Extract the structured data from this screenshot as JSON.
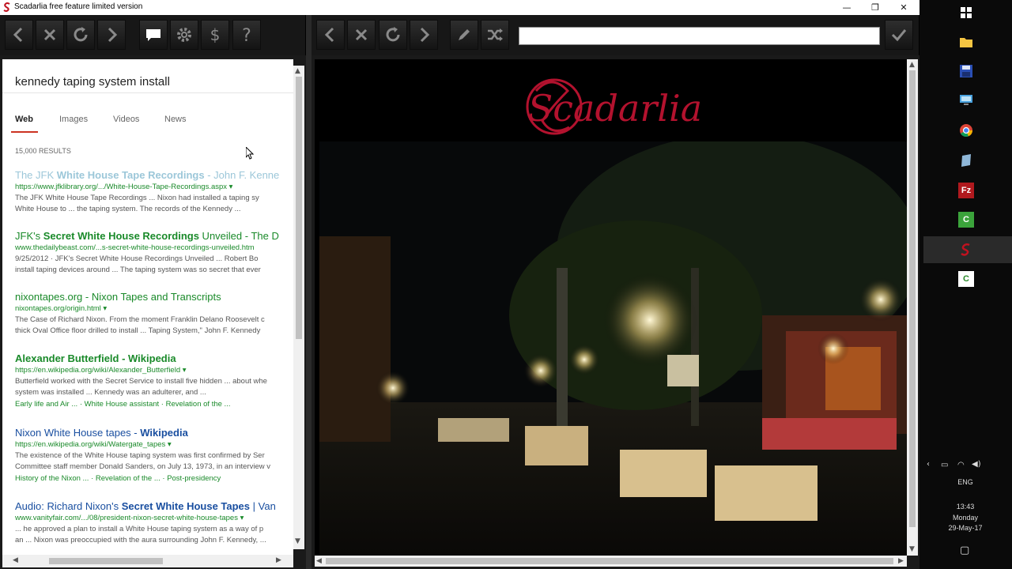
{
  "window": {
    "title": "Scadarlia free feature limited version",
    "controls": [
      "—",
      "❐",
      "✕"
    ]
  },
  "toolbar_left": {
    "buttons": [
      "back-icon",
      "stop-icon",
      "refresh-icon",
      "forward-icon",
      "chat-icon",
      "gear-icon",
      "dollar-icon",
      "help-icon"
    ]
  },
  "toolbar_right": {
    "buttons": [
      "back-icon",
      "stop-icon",
      "refresh-icon",
      "forward-icon",
      "pencil-icon",
      "shuffle-icon"
    ],
    "url_value": "",
    "go_icon": "check-icon"
  },
  "search": {
    "query": "kennedy taping system install",
    "tabs": [
      {
        "label": "Web",
        "active": true
      },
      {
        "label": "Images",
        "active": false
      },
      {
        "label": "Videos",
        "active": false
      },
      {
        "label": "News",
        "active": false
      }
    ],
    "result_count": "15,000 RESULTS",
    "results": [
      {
        "title_pre": "The JFK ",
        "title_bold": "White House Tape Recordings",
        "title_post": " - John F. Kenne",
        "url": "https://www.jfklibrary.org/.../White-House-Tape-Recordings.aspx ▾",
        "snippet1": "The JFK White House Tape Recordings ... Nixon had installed a taping sy",
        "snippet2": "White House to ... the taping system. The records of the Kennedy ...",
        "links": ""
      },
      {
        "title_pre": "JFK's ",
        "title_bold": "Secret White House Recordings",
        "title_post": " Unveiled - The D",
        "url": "www.thedailybeast.com/...s-secret-white-house-recordings-unveiled.htm",
        "snippet1": "9/25/2012 · JFK's Secret White House Recordings Unveiled ... Robert Bo",
        "snippet2": "install taping devices around ... The taping system was so secret that ever",
        "links": ""
      },
      {
        "title_pre": "nixontapes.org - Nixon Tapes and Transcripts",
        "title_bold": "",
        "title_post": "",
        "url": "nixontapes.org/origin.html ▾",
        "snippet1": "The Case of Richard Nixon. From the moment Franklin Delano Roosevelt c",
        "snippet2": "thick Oval Office floor drilled to install ... Taping System,\" John F. Kennedy",
        "links": ""
      },
      {
        "title_pre": "",
        "title_bold": "Alexander Butterfield - Wikipedia",
        "title_post": "",
        "url": "https://en.wikipedia.org/wiki/Alexander_Butterfield ▾",
        "snippet1": "Butterfield worked with the Secret Service to install five hidden ... about whe",
        "snippet2": "system was installed ... Kennedy was an adulterer, and ...",
        "links": "Early life and Air ...  ·  White House assistant  ·  Revelation of the ..."
      },
      {
        "title_pre": "Nixon White House tapes - ",
        "title_bold": "Wikipedia",
        "title_post": "",
        "url": "https://en.wikipedia.org/wiki/Watergate_tapes ▾",
        "snippet1": "The existence of the White House taping system was first confirmed by Ser",
        "snippet2": "Committee staff member Donald Sanders, on July 13, 1973, in an interview v",
        "links": "History of the Nixon ...  ·  Revelation of the ...  ·  Post-presidency"
      },
      {
        "title_pre": "Audio: Richard Nixon's ",
        "title_bold": "Secret White House Tapes",
        "title_post": " | Van",
        "url": "www.vanityfair.com/.../08/president-nixon-secret-white-house-tapes ▾",
        "snippet1": "... he approved a plan to install a White House taping system as a way of p",
        "snippet2": "an ... Nixon was preoccupied with the aura surrounding John F. Kennedy, ...",
        "links": ""
      }
    ]
  },
  "right_page": {
    "logo_text": "Scadarlia",
    "logo_color": "#b3122e"
  },
  "system_tray": {
    "language": "ENG",
    "time": "13:43",
    "day": "Monday",
    "date": "29-May-17"
  },
  "taskbar_apps": [
    "windows-start-icon",
    "file-explorer-icon",
    "save-disk-icon",
    "monitor-icon",
    "chrome-icon",
    "notepad-icon",
    "filezilla-icon",
    "camtasia-icon",
    "scadarlia-icon",
    "camtasia-recorder-icon"
  ]
}
